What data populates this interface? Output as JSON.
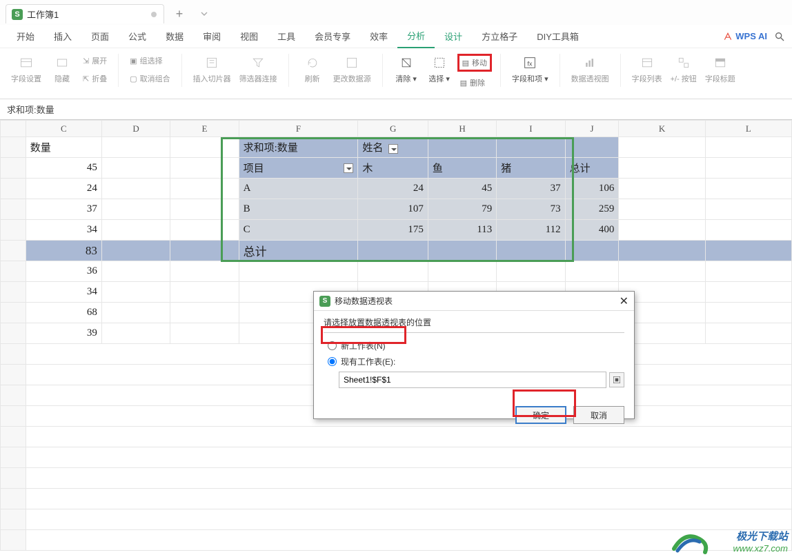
{
  "tab": {
    "title": "工作簿1",
    "badge": "S"
  },
  "addTab": "+",
  "menu": {
    "items": [
      "开始",
      "插入",
      "页面",
      "公式",
      "数据",
      "审阅",
      "视图",
      "工具",
      "会员专享",
      "效率",
      "分析",
      "设计",
      "方立格子",
      "DIY工具箱"
    ],
    "activeIndex": 10,
    "wpsAi": "WPS AI"
  },
  "ribbon": {
    "fieldSettings": "字段设置",
    "hide": "隐藏",
    "expand": "展开",
    "collapse": "折叠",
    "groupSelect": "组选择",
    "ungroup": "取消组合",
    "insertSlicer": "插入切片器",
    "filterConnect": "筛选器连接",
    "refresh": "刷新",
    "changeSource": "更改数据源",
    "clear": "清除",
    "select": "选择",
    "move": "移动",
    "delete": "删除",
    "fieldAndItem": "字段和项",
    "dataPivot": "数据透视图",
    "fieldList": "字段列表",
    "plusMinusBtn": "+/- 按钮",
    "fieldHeader": "字段标题"
  },
  "namebox": "求和项:数量",
  "columns": [
    "C",
    "D",
    "E",
    "F",
    "G",
    "H",
    "I",
    "J",
    "K",
    "L"
  ],
  "leftData": {
    "header": "数量",
    "values": [
      45,
      24,
      37,
      34,
      83,
      36,
      34,
      68,
      39
    ]
  },
  "pivot": {
    "title": "求和项:数量",
    "colFieldLabel": "姓名",
    "rowFieldLabel": "项目",
    "colHeaders": [
      "木",
      "鱼",
      "猪",
      "总计"
    ],
    "rows": [
      {
        "label": "A",
        "values": [
          24,
          45,
          37,
          106
        ]
      },
      {
        "label": "B",
        "values": [
          107,
          79,
          73,
          259
        ]
      },
      {
        "label": "C",
        "values": [
          175,
          113,
          112,
          400
        ]
      }
    ],
    "grandTotalLabel": "总计"
  },
  "dialog": {
    "title": "移动数据透视表",
    "prompt": "请选择放置数据透视表的位置",
    "optNewSheet": "新工作表(N)",
    "optExisting": "现有工作表(E):",
    "rangeValue": "Sheet1!$F$1",
    "ok": "确定",
    "cancel": "取消"
  },
  "watermark": {
    "line1": "极光下载站",
    "line2": "www.xz7.com"
  }
}
